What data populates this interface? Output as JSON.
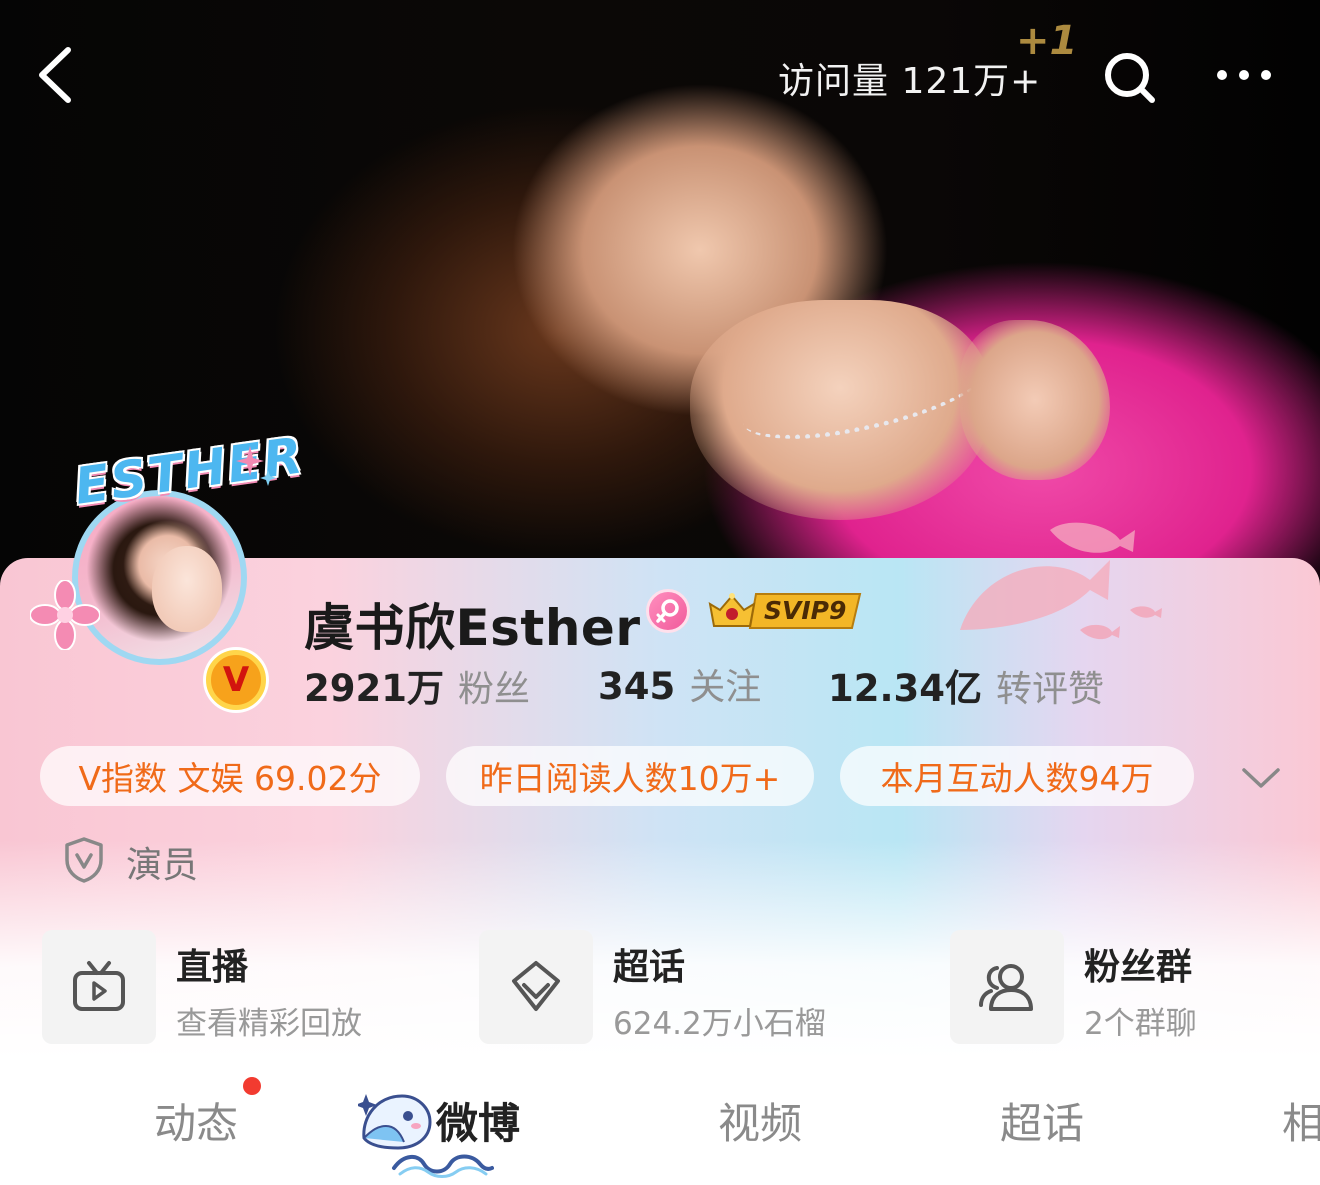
{
  "header": {
    "visits_text": "访问量 121万+",
    "plus_one": "+1"
  },
  "avatar": {
    "ring_text": "ESTHER",
    "verified_mark": "V"
  },
  "profile": {
    "name": "虞书欣Esther",
    "svip_label": "SVIP9",
    "role": "演员"
  },
  "stats": [
    {
      "value": "2921万",
      "label": "粉丝"
    },
    {
      "value": "345",
      "label": "关注"
    },
    {
      "value": "12.34亿",
      "label": "转评赞"
    }
  ],
  "tags": [
    "V指数 文娱 69.02分",
    "昨日阅读人数10万+",
    "本月互动人数94万"
  ],
  "features": [
    {
      "title": "直播",
      "subtitle": "查看精彩回放",
      "icon": "tv-icon"
    },
    {
      "title": "超话",
      "subtitle": "624.2万小石榴",
      "icon": "diamond-icon"
    },
    {
      "title": "粉丝群",
      "subtitle": "2个群聊",
      "icon": "group-icon"
    }
  ],
  "tabs": [
    {
      "label": "动态",
      "has_red_dot": true
    },
    {
      "label": "微博",
      "active": true
    },
    {
      "label": "视频"
    },
    {
      "label": "超话"
    },
    {
      "label": "相"
    }
  ],
  "colors": {
    "accent_orange": "#f06a19",
    "badge_gold": "#f7a21b",
    "red_dot": "#f23b30",
    "gender_pink": "#f15a9b"
  }
}
